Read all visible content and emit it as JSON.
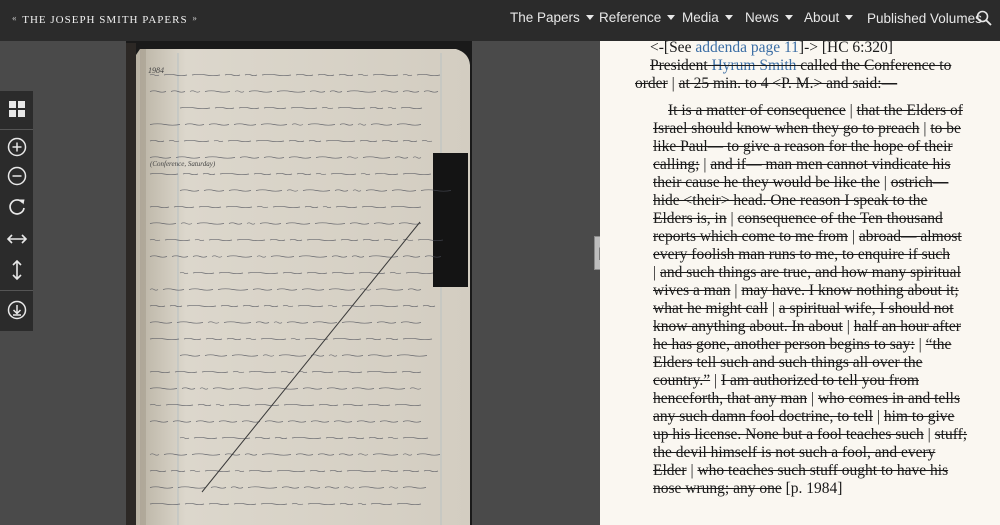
{
  "header": {
    "logo_left_ornament": "«",
    "logo_text": "THE JOSEPH SMITH PAPERS",
    "logo_right_ornament": "»",
    "nav": [
      {
        "label": "The Papers",
        "has_caret": true
      },
      {
        "label": "Reference",
        "has_caret": true
      },
      {
        "label": "Media",
        "has_caret": true
      },
      {
        "label": "News",
        "has_caret": true
      },
      {
        "label": "About",
        "has_caret": true
      },
      {
        "label": "Published Volumes",
        "has_caret": false
      }
    ],
    "search_icon": "search-icon"
  },
  "toolbar": {
    "tools": [
      "grid-view-icon",
      "zoom-in-icon",
      "zoom-out-icon",
      "rotate-icon",
      "fit-width-icon",
      "fit-height-icon",
      "download-icon"
    ]
  },
  "splitter_glyph": "||",
  "transcript": {
    "lines": [
      {
        "segments": [
          {
            "t": "<-[See ",
            "s": false
          },
          {
            "t": "addenda page 11",
            "s": false,
            "link": true
          },
          {
            "t": "]-> [HC 6:320]",
            "s": false
          }
        ]
      },
      {
        "segments": [
          {
            "t": "President ",
            "s": true
          },
          {
            "t": "Hyrum Smith",
            "s": true,
            "link": true
          },
          {
            "t": " called the Conference to",
            "s": true
          }
        ]
      },
      {
        "segments": [
          {
            "t": "order",
            "s": true
          },
          {
            "t": " | ",
            "s": false
          },
          {
            "t": "at 25 min. to 4 <P. M.> and said:—",
            "s": true
          }
        ]
      },
      {
        "segments": [
          {
            "t": "It is a matter of consequence",
            "s": true
          },
          {
            "t": " | ",
            "s": false
          },
          {
            "t": "that the Elders of",
            "s": true
          }
        ]
      },
      {
        "segments": [
          {
            "t": "Israel should know when they go to preach",
            "s": true
          },
          {
            "t": " | ",
            "s": false
          },
          {
            "t": "to be",
            "s": true
          }
        ]
      },
      {
        "segments": [
          {
            "t": "like Paul— to give a reason for the hope of their",
            "s": true
          }
        ]
      },
      {
        "segments": [
          {
            "t": "calling;",
            "s": true
          },
          {
            "t": " | ",
            "s": false
          },
          {
            "t": "and if— man men cannot vindicate his",
            "s": true
          }
        ]
      },
      {
        "segments": [
          {
            "t": "their cause he they would be like the",
            "s": true
          },
          {
            "t": " | ",
            "s": false
          },
          {
            "t": "ostrich—",
            "s": true
          }
        ]
      },
      {
        "segments": [
          {
            "t": "hide <their> head. One reason I speak to the",
            "s": true
          }
        ]
      },
      {
        "segments": [
          {
            "t": "Elders is, in",
            "s": true
          },
          {
            "t": " | ",
            "s": false
          },
          {
            "t": "consequence of the Ten thousand",
            "s": true
          }
        ]
      },
      {
        "segments": [
          {
            "t": "reports which come to me from",
            "s": true
          },
          {
            "t": " | ",
            "s": false
          },
          {
            "t": "abroad— almost",
            "s": true
          }
        ]
      },
      {
        "segments": [
          {
            "t": "every foolish man runs to me, to enquire if such",
            "s": true
          }
        ]
      },
      {
        "segments": [
          {
            "t": "| ",
            "s": false
          },
          {
            "t": "and such things are true, and how many spiritual",
            "s": true
          }
        ]
      },
      {
        "segments": [
          {
            "t": "wives a man",
            "s": true
          },
          {
            "t": " | ",
            "s": false
          },
          {
            "t": "may have. I know nothing about it;",
            "s": true
          }
        ]
      },
      {
        "segments": [
          {
            "t": "what he might call",
            "s": true
          },
          {
            "t": " | ",
            "s": false
          },
          {
            "t": "a spiritual wife, I should not",
            "s": true
          }
        ]
      },
      {
        "segments": [
          {
            "t": "know anything about. In about",
            "s": true
          },
          {
            "t": " | ",
            "s": false
          },
          {
            "t": "half an hour after",
            "s": true
          }
        ]
      },
      {
        "segments": [
          {
            "t": "he has gone, another person begins to say:",
            "s": true
          },
          {
            "t": " | ",
            "s": false
          },
          {
            "t": "“the",
            "s": true
          }
        ]
      },
      {
        "segments": [
          {
            "t": "Elders tell such and such things all over the",
            "s": true
          }
        ]
      },
      {
        "segments": [
          {
            "t": "country.”",
            "s": true
          },
          {
            "t": " | ",
            "s": false
          },
          {
            "t": "I am authorized to tell you from",
            "s": true
          }
        ]
      },
      {
        "segments": [
          {
            "t": "henceforth, that any man",
            "s": true
          },
          {
            "t": " | ",
            "s": false
          },
          {
            "t": "who comes in and tells",
            "s": true
          }
        ]
      },
      {
        "segments": [
          {
            "t": "any such damn fool doctrine, to tell",
            "s": true
          },
          {
            "t": " | ",
            "s": false
          },
          {
            "t": "him to give",
            "s": true
          }
        ]
      },
      {
        "segments": [
          {
            "t": "up his license. None but a fool teaches such",
            "s": true
          },
          {
            "t": " | ",
            "s": false
          },
          {
            "t": "stuff;",
            "s": true
          }
        ]
      },
      {
        "segments": [
          {
            "t": "the devil himself is not such a fool, and every",
            "s": true
          }
        ]
      },
      {
        "segments": [
          {
            "t": "Elder",
            "s": true
          },
          {
            "t": " | ",
            "s": false
          },
          {
            "t": "who teaches such stuff ought to have his",
            "s": true
          }
        ]
      },
      {
        "segments": [
          {
            "t": "nose wrung; any one",
            "s": true
          },
          {
            "t": " [p. 1984]",
            "s": false
          }
        ]
      }
    ]
  },
  "manuscript": {
    "page_number_text": "1984",
    "heading_text": "(Conference, Saturday)"
  },
  "colors": {
    "nav_bg": "#2b2b2b",
    "transcript_bg": "#faf7f1",
    "link": "#3b6ea5",
    "viewer_bg": "#4a4a4a"
  }
}
